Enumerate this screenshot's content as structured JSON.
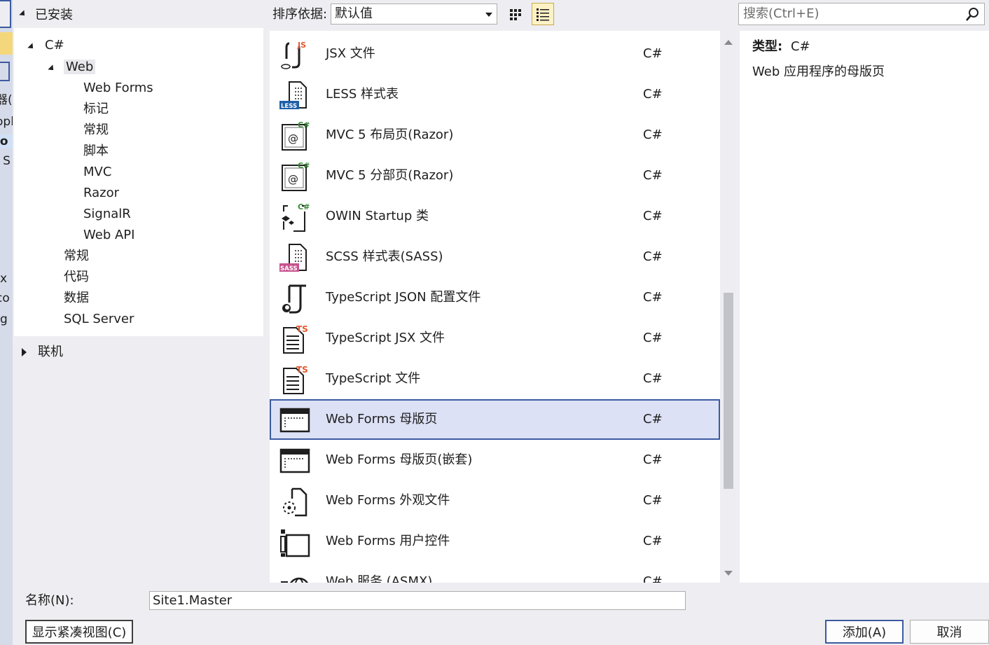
{
  "left_strip_fragments": [
    "器(",
    "opl",
    "io",
    "l S",
    "x",
    "co",
    "g"
  ],
  "tree": {
    "installed_label": "已安装",
    "csharp_label": "C#",
    "web_label": "Web",
    "web_children": [
      "Web Forms",
      "标记",
      "常规",
      "脚本",
      "MVC",
      "Razor",
      "SignalR",
      "Web API"
    ],
    "csharp_children": [
      "常规",
      "代码",
      "数据",
      "SQL Server"
    ],
    "online_label": "联机"
  },
  "sort": {
    "label": "排序依据:",
    "value": "默认值"
  },
  "search": {
    "placeholder": "搜索(Ctrl+E)"
  },
  "templates": [
    {
      "name": "JSX 文件",
      "lang": "C#",
      "icon": "jsx-file-icon"
    },
    {
      "name": "LESS 样式表",
      "lang": "C#",
      "icon": "less-stylesheet-icon"
    },
    {
      "name": "MVC 5 布局页(Razor)",
      "lang": "C#",
      "icon": "mvc-razor-icon"
    },
    {
      "name": "MVC 5 分部页(Razor)",
      "lang": "C#",
      "icon": "mvc-razor-icon"
    },
    {
      "name": "OWIN Startup 类",
      "lang": "C#",
      "icon": "owin-class-icon"
    },
    {
      "name": "SCSS 样式表(SASS)",
      "lang": "C#",
      "icon": "sass-stylesheet-icon"
    },
    {
      "name": "TypeScript JSON 配置文件",
      "lang": "C#",
      "icon": "typescript-json-icon"
    },
    {
      "name": "TypeScript JSX 文件",
      "lang": "C#",
      "icon": "typescript-file-icon"
    },
    {
      "name": "TypeScript 文件",
      "lang": "C#",
      "icon": "typescript-file-icon"
    },
    {
      "name": "Web Forms 母版页",
      "lang": "C#",
      "icon": "master-page-icon",
      "selected": true
    },
    {
      "name": "Web Forms 母版页(嵌套)",
      "lang": "C#",
      "icon": "master-page-icon"
    },
    {
      "name": "Web Forms 外观文件",
      "lang": "C#",
      "icon": "skin-file-icon"
    },
    {
      "name": "Web Forms 用户控件",
      "lang": "C#",
      "icon": "user-control-icon"
    },
    {
      "name": "Web 服务 (ASMX)",
      "lang": "C#",
      "icon": "web-service-icon"
    }
  ],
  "details": {
    "type_label": "类型:",
    "type_value": "C#",
    "description": "Web 应用程序的母版页"
  },
  "bottom": {
    "name_label": "名称(N):",
    "name_value": "Site1.Master",
    "compact_view_button": "显示紧凑视图(C)",
    "add_button": "添加(A)",
    "cancel_button": "取消"
  },
  "colors": {
    "selection_bg": "#dde1f6",
    "selection_border": "#3c5aa0",
    "list_view_toggle_bg": "#fdf2c6",
    "badge_green": "#388a34",
    "badge_orange": "#e4572e",
    "badge_blue": "#1f5fa8",
    "badge_pink": "#c6538c"
  }
}
